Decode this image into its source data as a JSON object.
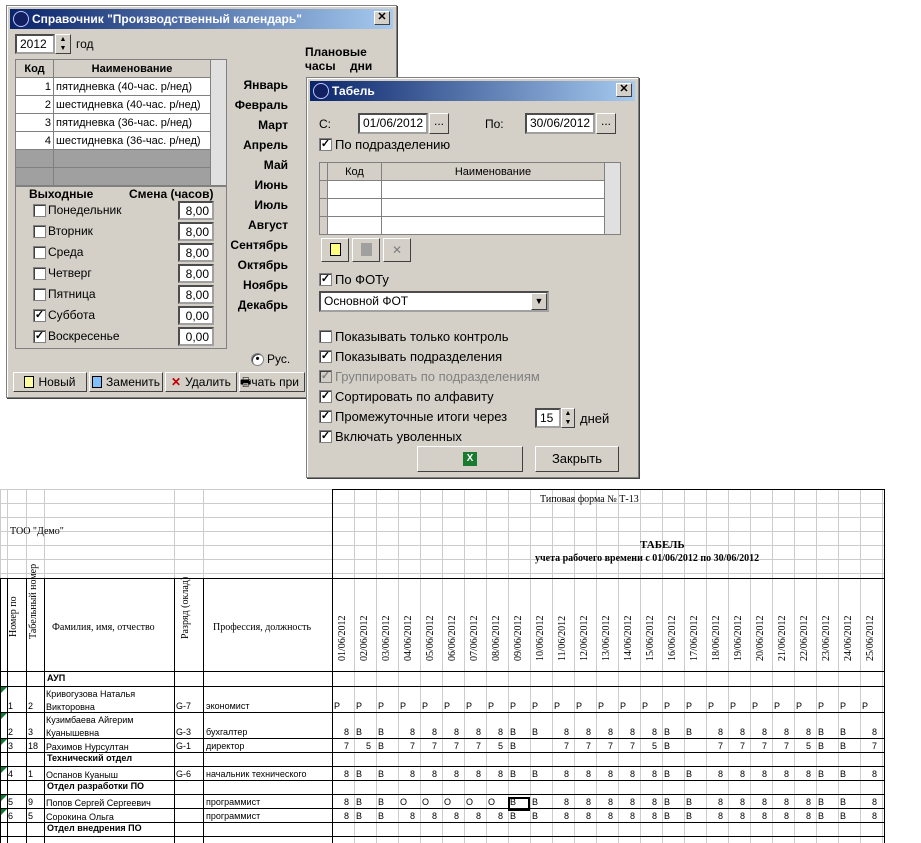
{
  "cal": {
    "title": "Справочник \"Производственный календарь\"",
    "year": "2012",
    "year_label": "год",
    "planned_hours": "Плановые\nчасы",
    "planned_days": "дни",
    "cols": [
      "Код",
      "Наименование"
    ],
    "rows": [
      [
        "1",
        "пятидневка (40-час. р/нед)"
      ],
      [
        "2",
        "шестидневка (40-час. р/нед)"
      ],
      [
        "3",
        "пятидневка (36-час. р/нед)"
      ],
      [
        "4",
        "шестидневка (36-час. р/нед)"
      ]
    ],
    "weekend_header": "Выходные",
    "shift_header": "Смена (часов)",
    "days": [
      {
        "name": "Понедельник",
        "checked": false,
        "hours": "8,00"
      },
      {
        "name": "Вторник",
        "checked": false,
        "hours": "8,00"
      },
      {
        "name": "Среда",
        "checked": false,
        "hours": "8,00"
      },
      {
        "name": "Четверг",
        "checked": false,
        "hours": "8,00"
      },
      {
        "name": "Пятница",
        "checked": false,
        "hours": "8,00"
      },
      {
        "name": "Суббота",
        "checked": true,
        "hours": "0,00"
      },
      {
        "name": "Воскресенье",
        "checked": true,
        "hours": "0,00"
      }
    ],
    "months": [
      "Январь",
      "Февраль",
      "Март",
      "Апрель",
      "Май",
      "Июнь",
      "Июль",
      "Август",
      "Сентябрь",
      "Октябрь",
      "Ноябрь",
      "Декабрь"
    ],
    "radio_label": "Рус.",
    "buttons": [
      "Новый",
      "Заменить",
      "Удалить",
      "чать при"
    ]
  },
  "tab": {
    "title": "Табель",
    "from_label": "С:",
    "from": "01/06/2012",
    "to_label": "По:",
    "to": "30/06/2012",
    "browse": "...",
    "by_dept": "По подразделению",
    "grid_cols": [
      "Код",
      "Наименование"
    ],
    "by_fot": "По ФОТу",
    "fot_value": "Основной ФОТ",
    "opts": [
      {
        "label": "Показывать только контроль",
        "checked": false,
        "disabled": false
      },
      {
        "label": "Показывать подразделения",
        "checked": true,
        "disabled": false
      },
      {
        "label": "Группировать по подразделениям",
        "checked": true,
        "disabled": true
      },
      {
        "label": "Сортировать по алфавиту",
        "checked": true,
        "disabled": false
      },
      {
        "label": "Промежуточные итоги через",
        "checked": true,
        "disabled": false
      },
      {
        "label": "Включать уволенных",
        "checked": true,
        "disabled": false
      }
    ],
    "interval": "15",
    "interval_unit": "дней",
    "close": "Закрыть"
  },
  "sheet": {
    "form": "Типовая форма № Т-13",
    "org": "ТОО \"Демо\"",
    "title": "ТАБЕЛЬ",
    "subtitle": "учета рабочего времени с 01/06/2012 по 30/06/2012",
    "h_num": "Номер по",
    "h_tab": "Табельный номер",
    "h_name": "Фамилия, имя, отчество",
    "h_grade": "Разряд (оклад)",
    "h_prof": "Профессия, должность",
    "dates": [
      "01/06/2012",
      "02/06/2012",
      "03/06/2012",
      "04/06/2012",
      "05/06/2012",
      "06/06/2012",
      "07/06/2012",
      "08/06/2012",
      "09/06/2012",
      "10/06/2012",
      "11/06/2012",
      "12/06/2012",
      "13/06/2012",
      "14/06/2012",
      "15/06/2012",
      "16/06/2012",
      "17/06/2012",
      "18/06/2012",
      "19/06/2012",
      "20/06/2012",
      "21/06/2012",
      "22/06/2012",
      "23/06/2012",
      "24/06/2012",
      "25/06/2012"
    ],
    "lines": [
      {
        "group": "АУП"
      },
      {
        "no": "1",
        "tn": "2",
        "name": "Кривогузова Наталья Викторовна",
        "grade": "G-7",
        "prof": "экономист",
        "v": [
          "Р",
          "Р",
          "Р",
          "Р",
          "Р",
          "Р",
          "Р",
          "Р",
          "Р",
          "Р",
          "Р",
          "Р",
          "Р",
          "Р",
          "Р",
          "Р",
          "Р",
          "Р",
          "Р",
          "Р",
          "Р",
          "Р",
          "Р",
          "Р",
          "Р"
        ]
      },
      {
        "no": "2",
        "tn": "3",
        "name": "Кузимбаева Айгерим Куанышевна",
        "grade": "G-3",
        "prof": "бухгалтер",
        "v": [
          "8",
          "В",
          "В",
          "8",
          "8",
          "8",
          "8",
          "8",
          "В",
          "В",
          "8",
          "8",
          "8",
          "8",
          "8",
          "В",
          "В",
          "8",
          "8",
          "8",
          "8",
          "8",
          "В",
          "В",
          "8"
        ]
      },
      {
        "no": "3",
        "tn": "18",
        "name": "Рахимов Нурсултан",
        "grade": "G-1",
        "prof": "директор",
        "v": [
          "7",
          "5",
          "В",
          "7",
          "7",
          "7",
          "7",
          "5",
          "В",
          "",
          "7",
          "7",
          "7",
          "7",
          "5",
          "В",
          "",
          "7",
          "7",
          "7",
          "7",
          "5",
          "В",
          "В",
          "7"
        ]
      },
      {
        "group": "Технический отдел"
      },
      {
        "no": "4",
        "tn": "1",
        "name": "Оспанов Куаныш",
        "grade": "G-6",
        "prof": "начальник технического",
        "v": [
          "8",
          "В",
          "В",
          "8",
          "8",
          "8",
          "8",
          "8",
          "В",
          "В",
          "8",
          "8",
          "8",
          "8",
          "8",
          "В",
          "В",
          "8",
          "8",
          "8",
          "8",
          "8",
          "В",
          "В",
          "8"
        ]
      },
      {
        "group": "Отдел разработки ПО"
      },
      {
        "no": "5",
        "tn": "9",
        "name": "Попов Сергей Сергеевич",
        "grade": "",
        "prof": "программист",
        "v": [
          "8",
          "В",
          "В",
          "О",
          "О",
          "О",
          "О",
          "О",
          "В",
          "В",
          "8",
          "8",
          "8",
          "8",
          "8",
          "В",
          "В",
          "8",
          "8",
          "8",
          "8",
          "8",
          "В",
          "В",
          "8"
        ]
      },
      {
        "no": "6",
        "tn": "5",
        "name": "Сорокина Ольга",
        "grade": "",
        "prof": "программист",
        "v": [
          "8",
          "В",
          "В",
          "8",
          "8",
          "8",
          "8",
          "8",
          "В",
          "В",
          "8",
          "8",
          "8",
          "8",
          "8",
          "В",
          "В",
          "8",
          "8",
          "8",
          "8",
          "8",
          "В",
          "В",
          "8"
        ]
      },
      {
        "group": "Отдел внедрения ПО"
      }
    ]
  }
}
